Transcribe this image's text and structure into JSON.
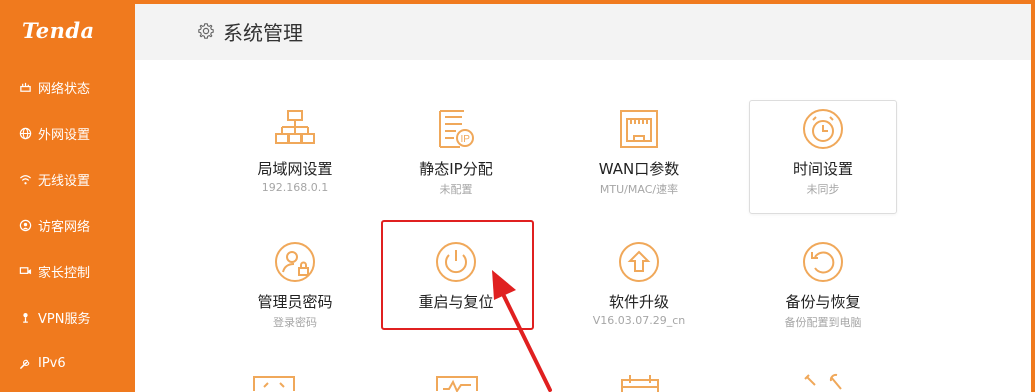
{
  "brand": {
    "logo": "Tenda"
  },
  "sidebar": {
    "items": [
      {
        "label": "网络状态",
        "icon": "network-status-icon"
      },
      {
        "label": "外网设置",
        "icon": "globe-icon"
      },
      {
        "label": "无线设置",
        "icon": "wifi-icon"
      },
      {
        "label": "访客网络",
        "icon": "guest-icon"
      },
      {
        "label": "家长控制",
        "icon": "parental-icon"
      },
      {
        "label": "VPN服务",
        "icon": "vpn-icon"
      },
      {
        "label": "IPv6",
        "icon": "wrench-icon"
      }
    ]
  },
  "header": {
    "title": "系统管理",
    "icon": "gear-icon"
  },
  "tiles": {
    "lan": {
      "label": "局域网设置",
      "sub": "192.168.0.1",
      "icon": "lan-topology-icon"
    },
    "static_ip": {
      "label": "静态IP分配",
      "sub": "未配置",
      "icon": "static-ip-icon"
    },
    "wan": {
      "label": "WAN口参数",
      "sub": "MTU/MAC/速率",
      "icon": "wan-port-icon"
    },
    "time": {
      "label": "时间设置",
      "sub": "未同步",
      "icon": "alarm-clock-icon"
    },
    "admin": {
      "label": "管理员密码",
      "sub": "登录密码",
      "icon": "admin-password-icon"
    },
    "reboot": {
      "label": "重启与复位",
      "sub": "",
      "icon": "power-icon"
    },
    "upgrade": {
      "label": "软件升级",
      "sub": "V16.03.07.29_cn",
      "icon": "upgrade-icon"
    },
    "backup": {
      "label": "备份与恢复",
      "sub": "备份配置到电脑",
      "icon": "restore-icon"
    }
  },
  "colors": {
    "accent": "#f07a1e",
    "icon_stroke": "#f0a85a",
    "highlight": "#e02020"
  }
}
